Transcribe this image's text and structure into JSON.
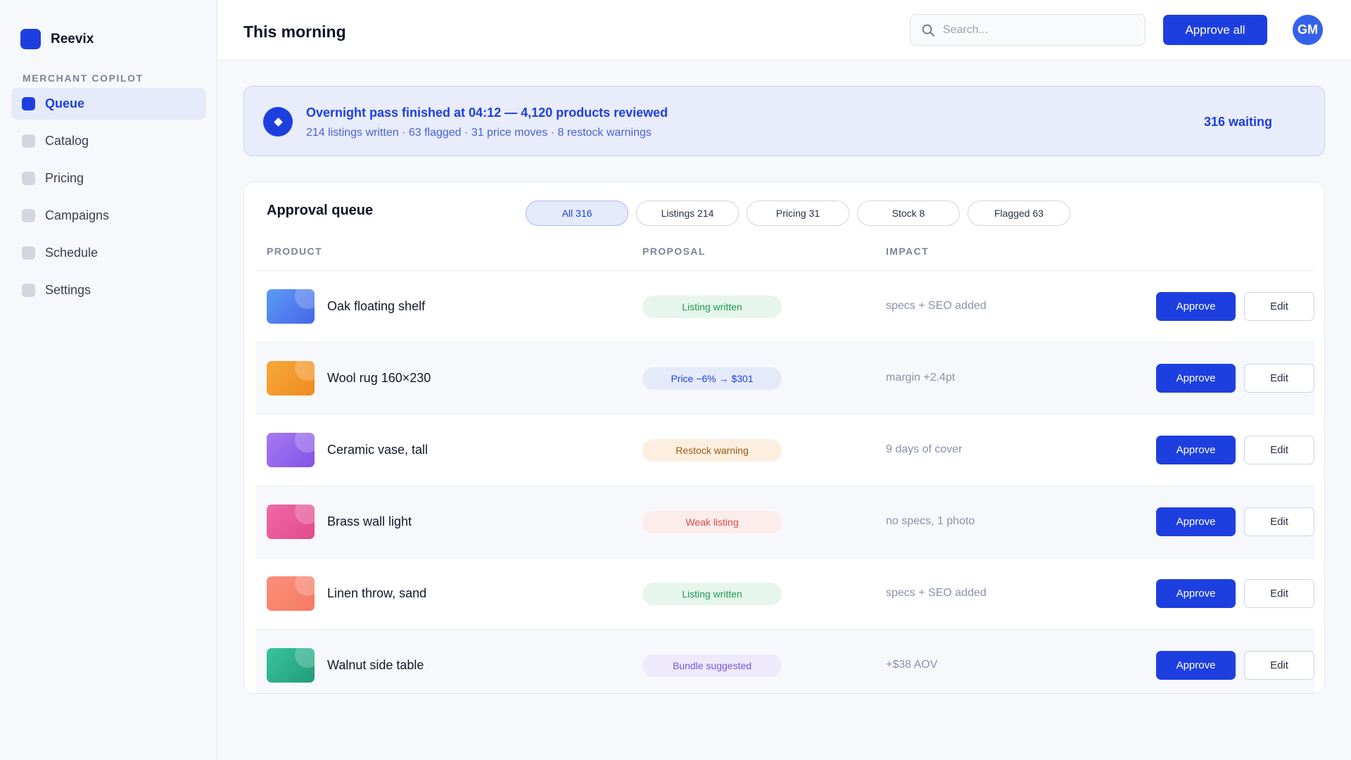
{
  "app": {
    "name": "Reevix",
    "section": "MERCHANT COPILOT"
  },
  "sidebar": {
    "items": [
      {
        "label": "Queue",
        "active": true
      },
      {
        "label": "Catalog"
      },
      {
        "label": "Pricing"
      },
      {
        "label": "Campaigns"
      },
      {
        "label": "Schedule"
      },
      {
        "label": "Settings"
      }
    ]
  },
  "header": {
    "title": "This morning",
    "search_placeholder": "Search...",
    "approve_all_label": "Approve all",
    "avatar_initials": "GM"
  },
  "banner": {
    "title": "Overnight pass finished at 04:12 — 4,120 products reviewed",
    "subtitle": "214 listings written · 63 flagged · 31 price moves · 8 restock warnings",
    "waiting": "316 waiting"
  },
  "queue": {
    "title": "Approval queue",
    "filters": [
      "All 316",
      "Listings 214",
      "Pricing 31",
      "Stock 8",
      "Flagged 63"
    ],
    "active_filter": 0,
    "columns": {
      "product": "PRODUCT",
      "proposal": "PROPOSAL",
      "impact": "IMPACT"
    },
    "approve_label": "Approve",
    "edit_label": "Edit",
    "rows": [
      {
        "product": "Oak floating shelf",
        "proposal": "Listing written",
        "impact": "specs + SEO added",
        "thumb_colors": [
          "#5b9cf6",
          "#4765e8"
        ],
        "badge_bg": "#e6f6ec",
        "badge_fg": "#1e9b55"
      },
      {
        "product": "Wool rug 160×230",
        "proposal": "Price −6% → $301",
        "impact": "margin +2.4pt",
        "thumb_colors": [
          "#f6a93b",
          "#f08a1e"
        ],
        "badge_bg": "#e5eafb",
        "badge_fg": "#1d3fe0"
      },
      {
        "product": "Ceramic vase, tall",
        "proposal": "Restock warning",
        "impact": "9 days of cover",
        "thumb_colors": [
          "#a57bf2",
          "#8452e6"
        ],
        "badge_bg": "#fcefe0",
        "badge_fg": "#9a5a12"
      },
      {
        "product": "Brass wall light",
        "proposal": "Weak listing",
        "impact": "no specs, 1 photo",
        "thumb_colors": [
          "#f16aa8",
          "#e04a8a"
        ],
        "badge_bg": "#fdecec",
        "badge_fg": "#e04848"
      },
      {
        "product": "Linen throw, sand",
        "proposal": "Listing written",
        "impact": "specs + SEO added",
        "thumb_colors": [
          "#fb8f7a",
          "#f57a62"
        ],
        "badge_bg": "#e6f6ec",
        "badge_fg": "#1e9b55"
      },
      {
        "product": "Walnut side table",
        "proposal": "Bundle suggested",
        "impact": "+$38 AOV",
        "thumb_colors": [
          "#38c49c",
          "#239b7a"
        ],
        "badge_bg": "#eeeafc",
        "badge_fg": "#7a55dc"
      }
    ]
  },
  "colors": {
    "accent": "#1d3fe0",
    "banner_bg": "#e8ecfb",
    "page_bg": "#f7f8fc"
  }
}
